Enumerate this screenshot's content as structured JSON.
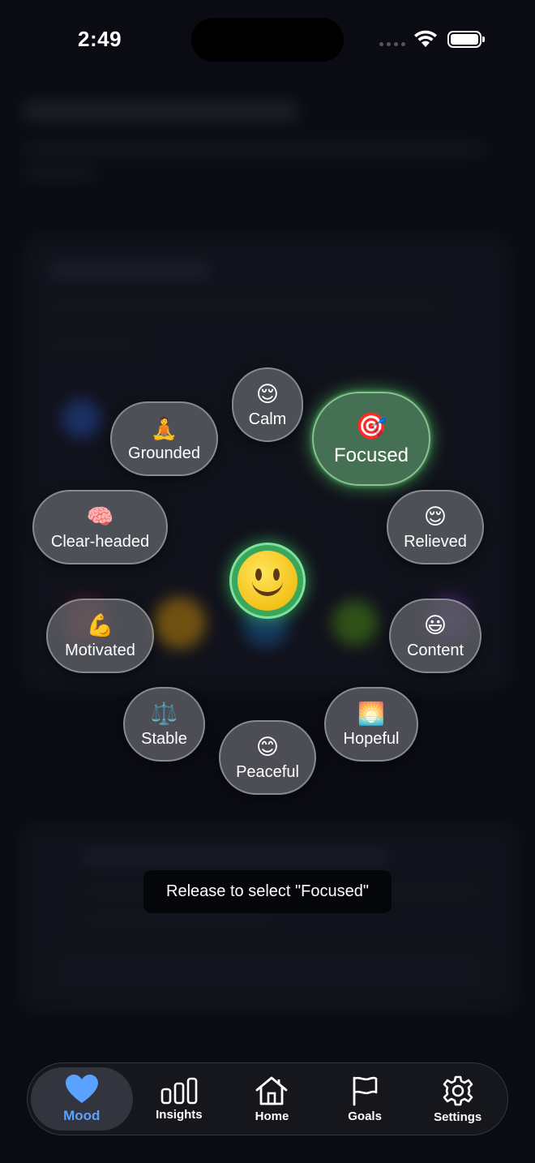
{
  "status_bar": {
    "time": "2:49"
  },
  "moods": [
    {
      "id": "calm",
      "emoji": "😌",
      "label": "Calm"
    },
    {
      "id": "focused",
      "emoji": "🎯",
      "label": "Focused",
      "selected": true
    },
    {
      "id": "grounded",
      "emoji": "🧘",
      "label": "Grounded"
    },
    {
      "id": "clear-headed",
      "emoji": "🧠",
      "label": "Clear-headed"
    },
    {
      "id": "relieved",
      "emoji": "😌",
      "label": "Relieved"
    },
    {
      "id": "motivated",
      "emoji": "💪",
      "label": "Motivated"
    },
    {
      "id": "content",
      "emoji": "😃",
      "label": "Content"
    },
    {
      "id": "stable",
      "emoji": "⚖️",
      "label": "Stable"
    },
    {
      "id": "hopeful",
      "emoji": "🌅",
      "label": "Hopeful"
    },
    {
      "id": "peaceful",
      "emoji": "😊",
      "label": "Peaceful"
    }
  ],
  "toast": {
    "text": "Release to select \"Focused\""
  },
  "tabs": [
    {
      "id": "mood",
      "label": "Mood",
      "icon": "heart-icon",
      "active": true
    },
    {
      "id": "insights",
      "label": "Insights",
      "icon": "bar-chart-icon"
    },
    {
      "id": "home",
      "label": "Home",
      "icon": "house-icon"
    },
    {
      "id": "goals",
      "label": "Goals",
      "icon": "flag-icon"
    },
    {
      "id": "settings",
      "label": "Settings",
      "icon": "gear-icon"
    }
  ],
  "colors": {
    "background": "#0b0c13",
    "selected_glow": "#5adc6e",
    "active_tab": "#5aa2ff"
  }
}
